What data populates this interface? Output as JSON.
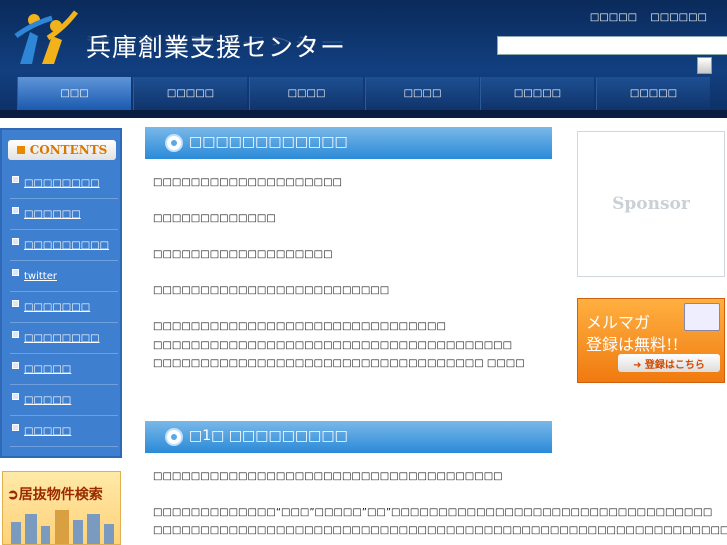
{
  "header": {
    "logo_text": "兵庫創業支援センター",
    "top_links": [
      "□□□□□",
      "□□□□□□"
    ],
    "search": {
      "placeholder": ""
    }
  },
  "nav": {
    "items": [
      "□□□",
      "□□□□□",
      "□□□□",
      "□□□□",
      "□□□□□",
      "□□□□□"
    ],
    "active_index": 0
  },
  "sidebar": {
    "contents_label": "CONTENTS",
    "items": [
      "□□□□□□□□",
      "□□□□□□",
      "□□□□□□□□□",
      "twitter",
      "□□□□□□□",
      "□□□□□□□□",
      "□□□□□",
      "□□□□□",
      "□□□□□"
    ],
    "banner_label": "居抜物件検索"
  },
  "main": {
    "section1": {
      "heading": "□□□□□□□□□□□□",
      "lines": [
        "□□□□□□□□□□□□□□□□□□□□",
        "□□□□□□□□□□□□□",
        "□□□□□□□□□□□□□□□□□□□",
        "□□□□□□□□□□□□□□□□□□□□□□□□□",
        "□□□□□□□□□□□□□□□□□□□□□□□□□□□□□□□",
        "□□□□□□□□□□□□□□□□□□□□□□□□□□□□□□□□□□□□□□",
        "□□□□□□□□□□□□□□□□□□□□□□□□□□□□□□□□□□□ □□□□"
      ]
    },
    "section2": {
      "heading": "□1□ □□□□□□□□□",
      "lines": [
        "□□□□□□□□□□□□□□□□□□□□□□□□□□□□□□□□□□□□□",
        "□□□□□□□□□□□□□“□□□”□□□□□”□□”□□□□□□□□□□□□□□□□□□□□□□□□□□□□□□□□□□",
        "□□□□□□□□□□□□□□□□□□□□□□□□□□□□□□□□□□□□□□□□□□□□□□□□□□□□□□□□□□□□□□□"
      ]
    }
  },
  "right": {
    "sponsor_label": "Sponsor",
    "merumaga": {
      "line1": "メルマガ",
      "line2": "登録は無料!!",
      "button": "➜ 登録はこちら"
    }
  },
  "colors": {
    "header_bg": "#123f80",
    "nav_active": "#1c5ab0",
    "sidebar_bg": "#3f7fd0",
    "heading_bar": "#2a8ad8",
    "merumaga_orange": "#f07a10"
  }
}
